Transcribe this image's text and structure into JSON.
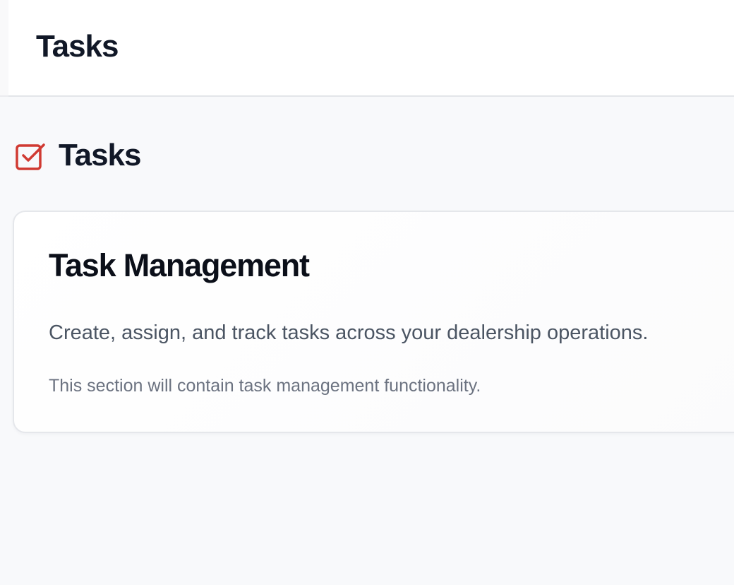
{
  "topbar": {
    "title": "Tasks"
  },
  "page": {
    "title": "Tasks",
    "icon": "checkbox-icon",
    "accent_color": "#d03a32"
  },
  "card": {
    "title": "Task Management",
    "description": "Create, assign, and track tasks across your dealership operations.",
    "note": "This section will contain task management functionality."
  }
}
